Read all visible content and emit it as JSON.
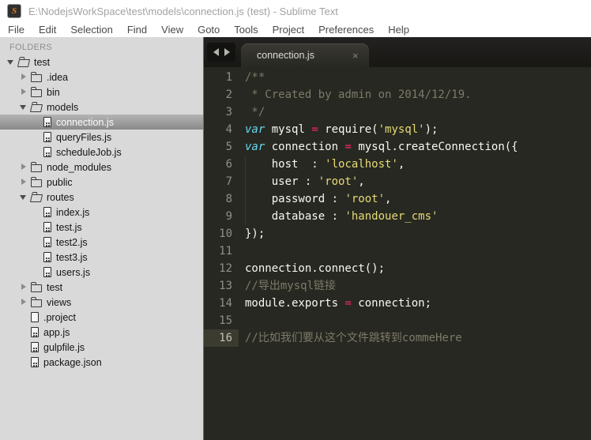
{
  "window": {
    "title": "E:\\NodejsWorkSpace\\test\\models\\connection.js (test) - Sublime Text",
    "icon_letter": "S"
  },
  "menu": {
    "items": [
      "File",
      "Edit",
      "Selection",
      "Find",
      "View",
      "Goto",
      "Tools",
      "Project",
      "Preferences",
      "Help"
    ]
  },
  "sidebar": {
    "heading": "FOLDERS",
    "items": [
      {
        "label": "test",
        "level": 0,
        "kind": "folder-open",
        "arrow": "down"
      },
      {
        "label": ".idea",
        "level": 1,
        "kind": "folder",
        "arrow": "right"
      },
      {
        "label": "bin",
        "level": 1,
        "kind": "folder",
        "arrow": "right"
      },
      {
        "label": "models",
        "level": 1,
        "kind": "folder-open",
        "arrow": "down"
      },
      {
        "label": "connection.js",
        "level": 2,
        "kind": "file-js",
        "selected": true
      },
      {
        "label": "queryFiles.js",
        "level": 2,
        "kind": "file-js"
      },
      {
        "label": "scheduleJob.js",
        "level": 2,
        "kind": "file-js"
      },
      {
        "label": "node_modules",
        "level": 1,
        "kind": "folder",
        "arrow": "right"
      },
      {
        "label": "public",
        "level": 1,
        "kind": "folder",
        "arrow": "right"
      },
      {
        "label": "routes",
        "level": 1,
        "kind": "folder-open",
        "arrow": "down"
      },
      {
        "label": "index.js",
        "level": 2,
        "kind": "file-js"
      },
      {
        "label": "test.js",
        "level": 2,
        "kind": "file-js"
      },
      {
        "label": "test2.js",
        "level": 2,
        "kind": "file-js"
      },
      {
        "label": "test3.js",
        "level": 2,
        "kind": "file-js"
      },
      {
        "label": "users.js",
        "level": 2,
        "kind": "file-js"
      },
      {
        "label": "test",
        "level": 1,
        "kind": "folder",
        "arrow": "right"
      },
      {
        "label": "views",
        "level": 1,
        "kind": "folder",
        "arrow": "right"
      },
      {
        "label": ".project",
        "level": 1,
        "kind": "file-plain"
      },
      {
        "label": "app.js",
        "level": 1,
        "kind": "file-js"
      },
      {
        "label": "gulpfile.js",
        "level": 1,
        "kind": "file-js"
      },
      {
        "label": "package.json",
        "level": 1,
        "kind": "file-js"
      }
    ]
  },
  "editor": {
    "tab": {
      "label": "connection.js",
      "close_glyph": "×"
    },
    "colors": {
      "background": "#272822",
      "keyword": "#66d9ef",
      "operator": "#f92672",
      "string": "#e6db74",
      "comment": "#7d7a68",
      "plain": "#f8f8f2",
      "line_number": "#8f908a",
      "active_gutter_bg": "#3c3b30",
      "sidebar_bg": "#d9d9d9",
      "selection_gradient": [
        "#b4b4b4",
        "#898989"
      ]
    },
    "lines": [
      {
        "num": 1,
        "segs": [
          {
            "c": "comment",
            "t": "/**"
          }
        ]
      },
      {
        "num": 2,
        "segs": [
          {
            "c": "comment",
            "t": " * Created by admin on 2014/12/19."
          }
        ]
      },
      {
        "num": 3,
        "segs": [
          {
            "c": "comment",
            "t": " */"
          }
        ]
      },
      {
        "num": 4,
        "segs": [
          {
            "c": "keyword",
            "t": "var"
          },
          {
            "c": "plain",
            "t": " mysql "
          },
          {
            "c": "operator",
            "t": "="
          },
          {
            "c": "plain",
            "t": " require("
          },
          {
            "c": "string",
            "t": "'mysql'"
          },
          {
            "c": "plain",
            "t": ");"
          }
        ]
      },
      {
        "num": 5,
        "segs": [
          {
            "c": "keyword",
            "t": "var"
          },
          {
            "c": "plain",
            "t": " connection "
          },
          {
            "c": "operator",
            "t": "="
          },
          {
            "c": "plain",
            "t": " mysql.createConnection({"
          }
        ]
      },
      {
        "num": 6,
        "guide": true,
        "segs": [
          {
            "c": "plain",
            "t": "    host  : "
          },
          {
            "c": "string",
            "t": "'localhost'"
          },
          {
            "c": "plain",
            "t": ","
          }
        ]
      },
      {
        "num": 7,
        "guide": true,
        "segs": [
          {
            "c": "plain",
            "t": "    user : "
          },
          {
            "c": "string",
            "t": "'root'"
          },
          {
            "c": "plain",
            "t": ","
          }
        ]
      },
      {
        "num": 8,
        "guide": true,
        "segs": [
          {
            "c": "plain",
            "t": "    password : "
          },
          {
            "c": "string",
            "t": "'root'"
          },
          {
            "c": "plain",
            "t": ","
          }
        ]
      },
      {
        "num": 9,
        "guide": true,
        "segs": [
          {
            "c": "plain",
            "t": "    database : "
          },
          {
            "c": "string",
            "t": "'handouer_cms'"
          }
        ]
      },
      {
        "num": 10,
        "segs": [
          {
            "c": "plain",
            "t": "});"
          }
        ]
      },
      {
        "num": 11,
        "segs": []
      },
      {
        "num": 12,
        "segs": [
          {
            "c": "plain",
            "t": "connection.connect();"
          }
        ]
      },
      {
        "num": 13,
        "segs": [
          {
            "c": "comment",
            "t": "//导出mysql链接"
          }
        ]
      },
      {
        "num": 14,
        "segs": [
          {
            "c": "plain",
            "t": "module.exports "
          },
          {
            "c": "operator",
            "t": "="
          },
          {
            "c": "plain",
            "t": " connection;"
          }
        ]
      },
      {
        "num": 15,
        "segs": []
      },
      {
        "num": 16,
        "active": true,
        "segs": [
          {
            "c": "comment",
            "t": "//比如我们要从这个文件跳转到commeHere"
          }
        ]
      }
    ]
  }
}
